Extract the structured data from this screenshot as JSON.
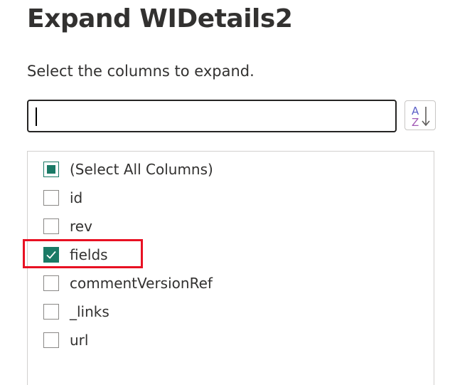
{
  "dialog": {
    "title": "Expand WIDetails2",
    "subtitle": "Select the columns to expand."
  },
  "search": {
    "value": "",
    "placeholder": ""
  },
  "sort_button": {
    "icon": "sort-az-icon",
    "label_a": "A",
    "label_z": "Z"
  },
  "columns": [
    {
      "label": "(Select All Columns)",
      "state": "partial"
    },
    {
      "label": "id",
      "state": "unchecked"
    },
    {
      "label": "rev",
      "state": "unchecked"
    },
    {
      "label": "fields",
      "state": "checked"
    },
    {
      "label": "commentVersionRef",
      "state": "unchecked"
    },
    {
      "label": "_links",
      "state": "unchecked"
    },
    {
      "label": "url",
      "state": "unchecked"
    }
  ],
  "colors": {
    "accent": "#1a7a66",
    "highlight": "#e81123"
  }
}
